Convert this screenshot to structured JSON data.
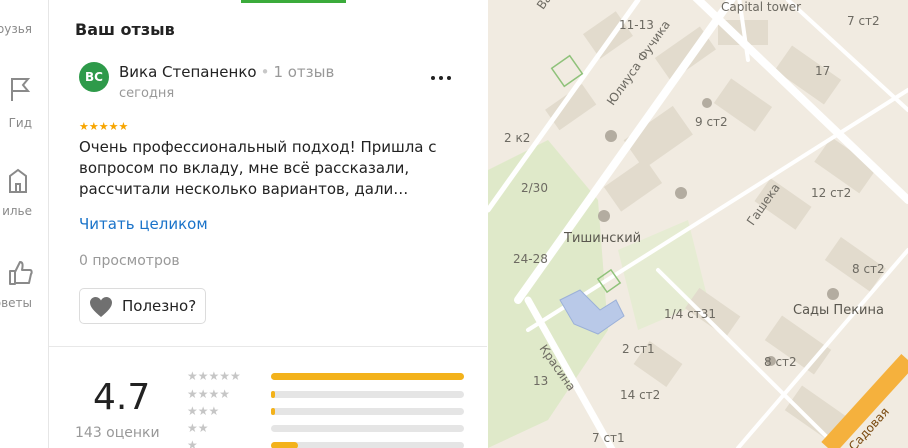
{
  "sidebar": {
    "items": [
      {
        "icon": "friends-icon",
        "label": "рузья"
      },
      {
        "icon": "flag-icon",
        "label": "Гид"
      },
      {
        "icon": "building-icon",
        "label": "илье"
      },
      {
        "icon": "thumbs-up-icon",
        "label": "оветы"
      }
    ]
  },
  "review_section": {
    "title": "Ваш отзыв",
    "author": {
      "initials": "ВС",
      "name": "Вика Степаненко",
      "review_count": "1 отзыв",
      "date": "сегодня",
      "avatar_color": "#2e9a4a"
    },
    "stars": "★★★★★",
    "rating_stars": 5,
    "text": "Очень профессиональный подход! Пришла с вопросом по вкладу, мне всё рассказали, рассчитали несколько вариантов, дали…",
    "read_more": "Читать целиком",
    "views": "0 просмотров",
    "helpful_label": "Полезно?"
  },
  "rating_summary": {
    "value": "4.7",
    "count": "143 оценки",
    "bars": [
      {
        "stars": "★★★★★",
        "fraction": 1.0
      },
      {
        "stars": "★★★★",
        "fraction": 0.02
      },
      {
        "stars": "★★★",
        "fraction": 0.02
      },
      {
        "stars": "★★",
        "fraction": 0.0
      },
      {
        "stars": "★",
        "fraction": 0.14
      }
    ]
  },
  "map": {
    "labels": [
      "Васи",
      "Capital tower",
      "7 ст2",
      "11-13",
      "Юлиуса Фучика",
      "17",
      "9 ст2",
      "2 к2",
      "2/30",
      "Гашека",
      "12 ст2",
      "Тишинский",
      "24-28",
      "8 ст2",
      "Сады Пекина",
      "1/4 ст31",
      "Красина",
      "2 ст1",
      "8 ст2",
      "13",
      "14 ст2",
      "7 ст1",
      "Садовая"
    ]
  },
  "colors": {
    "accent_green": "#3bab3b",
    "link_blue": "#1a73c9",
    "star_gold": "#f7a500",
    "bar_fill": "#f3b21b"
  }
}
